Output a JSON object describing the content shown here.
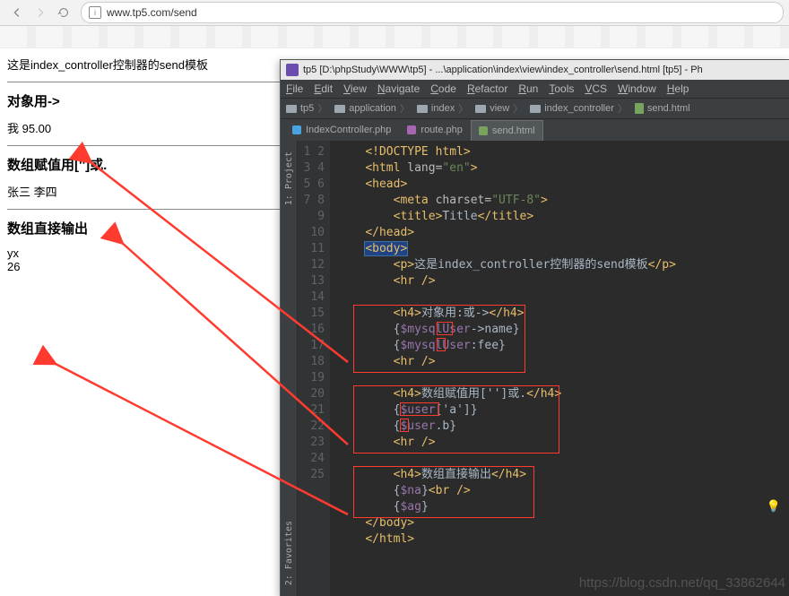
{
  "browser": {
    "url": "www.tp5.com/send",
    "info_char": "i"
  },
  "web": {
    "intro": "这是index_controller控制器的send模板",
    "h1": "对象用->",
    "line1": "我 95.00",
    "h2": "数组赋值用['']或.",
    "line2": "张三 李四",
    "h3": "数组直接输出",
    "line3a": "yx",
    "line3b": "26"
  },
  "ide": {
    "title": "tp5 [D:\\phpStudy\\WWW\\tp5] - ...\\application\\index\\view\\index_controller\\send.html [tp5] - Ph",
    "menu": [
      "File",
      "Edit",
      "View",
      "Navigate",
      "Code",
      "Refactor",
      "Run",
      "Tools",
      "VCS",
      "Window",
      "Help"
    ],
    "crumbs": [
      "tp5",
      "application",
      "index",
      "view",
      "index_controller",
      "send.html"
    ],
    "tabs": [
      {
        "label": "IndexController.php",
        "icon": "c"
      },
      {
        "label": "route.php",
        "icon": "p"
      },
      {
        "label": "send.html",
        "icon": "h",
        "active": true
      }
    ],
    "side_tabs": {
      "top": "1: Project",
      "bottom": "2: Favorites"
    },
    "code_lines": [
      {
        "n": 1,
        "html": "<span class='kw'>&lt;!DOCTYPE html&gt;</span>"
      },
      {
        "n": 2,
        "html": "<span class='kw'>&lt;html </span><span class='attr'>lang=</span><span class='str'>\"en\"</span><span class='kw'>&gt;</span>"
      },
      {
        "n": 3,
        "html": "<span class='kw'>&lt;head&gt;</span>"
      },
      {
        "n": 4,
        "html": "    <span class='kw'>&lt;meta </span><span class='attr'>charset=</span><span class='str'>\"UTF-8\"</span><span class='kw'>&gt;</span>"
      },
      {
        "n": 5,
        "html": "    <span class='kw'>&lt;title&gt;</span><span class='txt'>Title</span><span class='kw'>&lt;/title&gt;</span>"
      },
      {
        "n": 6,
        "html": "<span class='kw'>&lt;/head&gt;</span>"
      },
      {
        "n": 7,
        "html": "<span class='bodyhl'><span class='kw'>&lt;body&gt;</span></span>"
      },
      {
        "n": 8,
        "html": "    <span class='kw'>&lt;p&gt;</span><span class='txt'>这是index_controller控制器的send模板</span><span class='kw'>&lt;/p&gt;</span>"
      },
      {
        "n": 9,
        "html": "    <span class='kw'>&lt;hr /&gt;</span>"
      },
      {
        "n": 10,
        "html": ""
      },
      {
        "n": 11,
        "html": "    <span class='kw'>&lt;h4&gt;</span><span class='txt'>对象用:或-&gt;</span><span class='kw'>&lt;/h4&gt;</span>"
      },
      {
        "n": 12,
        "html": "    <span class='txt'>{</span><span class='var'>$mysqlUser</span><span class='txt'>-&gt;name}</span>"
      },
      {
        "n": 13,
        "html": "    <span class='txt'>{</span><span class='var'>$mysqlUser</span><span class='txt'>:fee}</span>"
      },
      {
        "n": 14,
        "html": "    <span class='kw'>&lt;hr /&gt;</span>"
      },
      {
        "n": 15,
        "html": ""
      },
      {
        "n": 16,
        "html": "    <span class='kw'>&lt;h4&gt;</span><span class='txt'>数组赋值用['']或.</span><span class='kw'>&lt;/h4&gt;</span>"
      },
      {
        "n": 17,
        "html": "    <span class='txt'>{</span><span class='var'>$user</span><span class='txt'>['a']}</span>"
      },
      {
        "n": 18,
        "html": "    <span class='txt'>{</span><span class='var'>$user</span><span class='txt'>.b}</span>"
      },
      {
        "n": 19,
        "html": "    <span class='kw'>&lt;hr /&gt;</span>"
      },
      {
        "n": 20,
        "html": ""
      },
      {
        "n": 21,
        "html": "    <span class='kw'>&lt;h4&gt;</span><span class='txt'>数组直接输出</span><span class='kw'>&lt;/h4&gt;</span>"
      },
      {
        "n": 22,
        "html": "    <span class='txt'>{</span><span class='var'>$na</span><span class='txt'>}</span><span class='kw'>&lt;br /&gt;</span>"
      },
      {
        "n": 23,
        "html": "    <span class='txt'>{</span><span class='var'>$ag</span><span class='txt'>}</span>"
      },
      {
        "n": 24,
        "html": "<span class='kw'>&lt;/body&gt;</span>"
      },
      {
        "n": 25,
        "html": "<span class='kw'>&lt;/html&gt;</span>"
      }
    ]
  },
  "watermark": "https://blog.csdn.net/qq_33862644"
}
